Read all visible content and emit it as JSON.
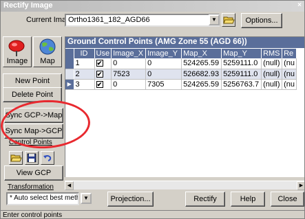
{
  "window": {
    "title": "Rectify Image",
    "close_glyph": "×"
  },
  "current_image": {
    "label": "Current Image",
    "value": "Ortho1361_182_AGD66",
    "options_label": "Options..."
  },
  "left_panel": {
    "image_label": "Image",
    "map_label": "Map",
    "new_point": "New Point",
    "delete_point": "Delete Point",
    "sync_gcp_map": "Sync GCP->Map",
    "sync_map_gcp": "Sync Map->GCP",
    "control_points_label": "Control Points",
    "view_gcp": "View GCP"
  },
  "grid": {
    "title": "Ground Control Points (AMG Zone 55 (AGD 66))",
    "columns": [
      "ID",
      "Use",
      "Image_X",
      "Image_Y",
      "Map_X",
      "Map_Y",
      "RMS",
      "Re"
    ],
    "rows": [
      {
        "id": "1",
        "use": "✔",
        "image_x": "0",
        "image_y": "0",
        "map_x": "524265.59",
        "map_y": "5259111.0",
        "rms": "(null)",
        "re": "(nu"
      },
      {
        "id": "2",
        "use": "✔",
        "image_x": "7523",
        "image_y": "0",
        "map_x": "526682.93",
        "map_y": "5259111.0",
        "rms": "(null)",
        "re": "(nu"
      },
      {
        "id": "3",
        "use": "✔",
        "image_x": "0",
        "image_y": "7305",
        "map_x": "524265.59",
        "map_y": "5256763.7",
        "rms": "(null)",
        "re": "(nu"
      }
    ]
  },
  "transformation": {
    "label": "Transformation",
    "value": "* Auto select best method *",
    "projection": "Projection...",
    "rectify": "Rectify",
    "help": "Help",
    "close": "Close"
  },
  "status": {
    "text": "Enter control points"
  },
  "colors": {
    "grid_header": "#5a6e9a",
    "annotation": "#e8292f",
    "window_bg": "#d4d0c8"
  }
}
